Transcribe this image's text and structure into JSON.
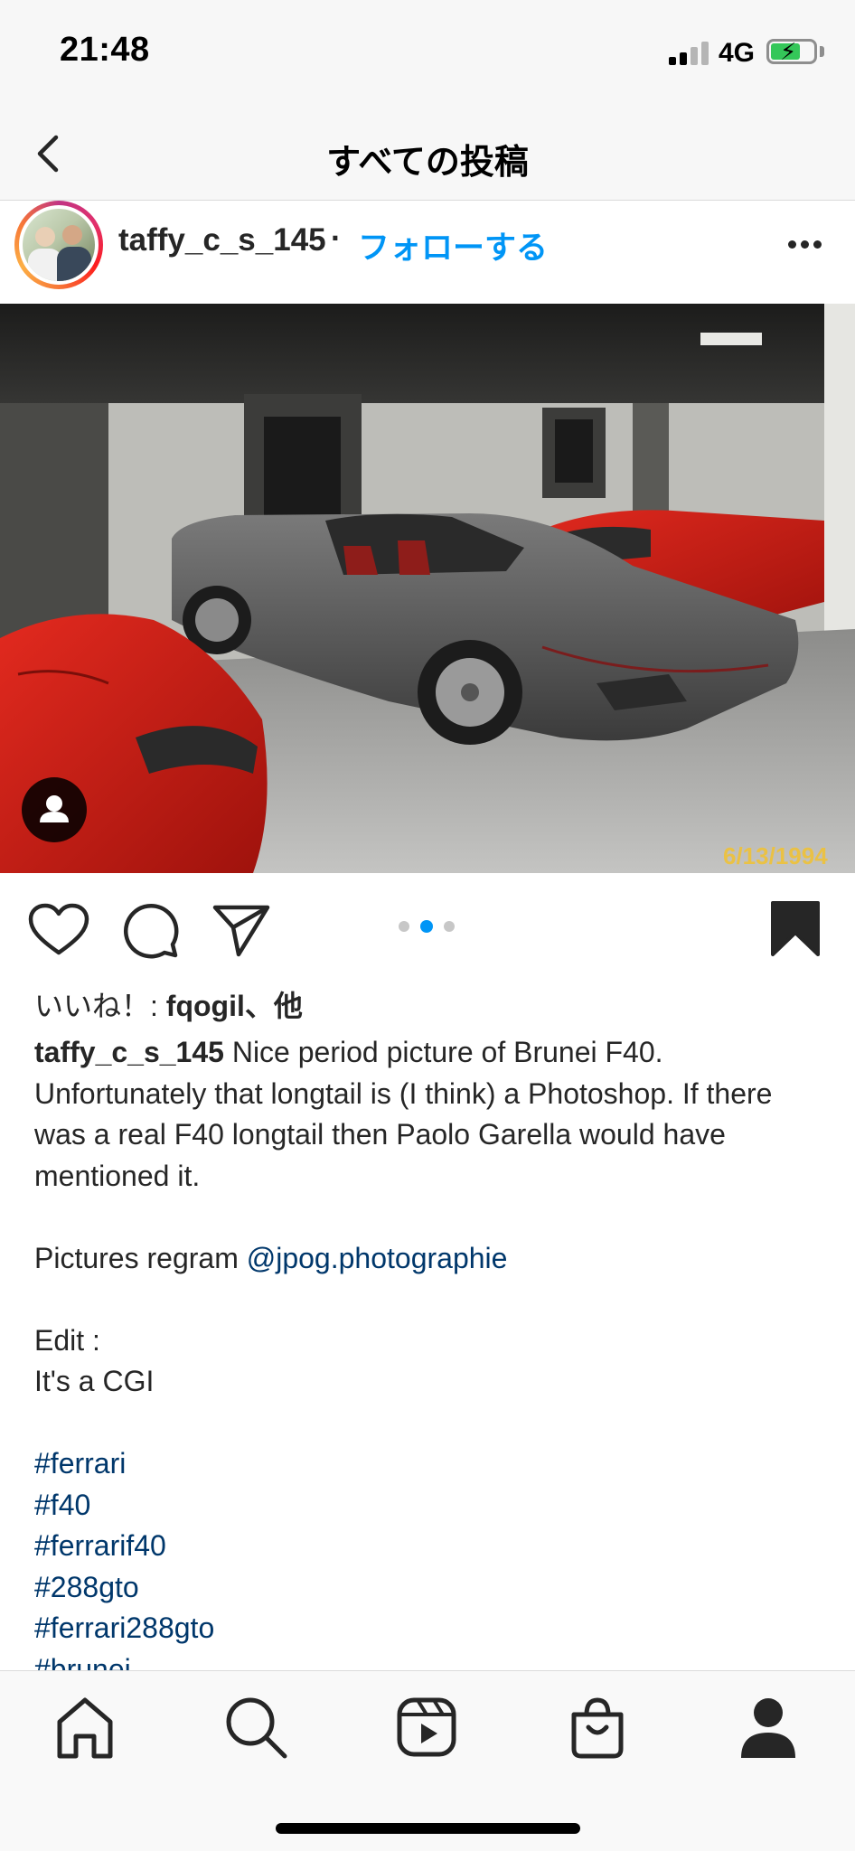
{
  "status_bar": {
    "time": "21:48",
    "network": "4G",
    "battery_level": 0.75,
    "battery_color": "#34c759"
  },
  "nav": {
    "title": "すべての投稿",
    "back_icon": "chevron-left-icon"
  },
  "post": {
    "username": "taffy_c_s_145",
    "separator": "·",
    "follow_label": "フォローする",
    "follow_color": "#0095f6",
    "more_icon": "more-horizontal-icon",
    "photo": {
      "date_stamp": "6/13/1994",
      "tag_icon": "person-tag-icon"
    },
    "actions": {
      "like_icon": "heart-icon",
      "comment_icon": "comment-icon",
      "share_icon": "send-icon",
      "save_icon": "bookmark-filled-icon",
      "carousel_total": 3,
      "carousel_active": 2,
      "active_dot_color": "#0095f6"
    },
    "likes": {
      "prefix": "いいね！: ",
      "user": "fqogil",
      "suffix": "、他"
    },
    "caption": {
      "user": "taffy_c_s_145",
      "text": " Nice period picture of Brunei F40. Unfortunately that longtail is (I think) a Photoshop. If there was a real F40 longtail then Paolo Garella would have mentioned it.",
      "pictures_prefix": "Pictures regram ",
      "pictures_link": "@jpog.photographie",
      "edit_label": "Edit :",
      "edit_text": "It's a CGI",
      "hashtags": [
        "#ferrari",
        "#f40",
        "#ferrarif40",
        "#288gto",
        "#ferrari288gto",
        "#brunei"
      ],
      "link_color": "#00376b"
    }
  },
  "tab_bar": {
    "items": [
      {
        "name": "home",
        "icon": "home-icon"
      },
      {
        "name": "search",
        "icon": "search-icon"
      },
      {
        "name": "reels",
        "icon": "reels-icon"
      },
      {
        "name": "shop",
        "icon": "shopping-bag-icon"
      },
      {
        "name": "profile",
        "icon": "profile-icon"
      }
    ]
  }
}
